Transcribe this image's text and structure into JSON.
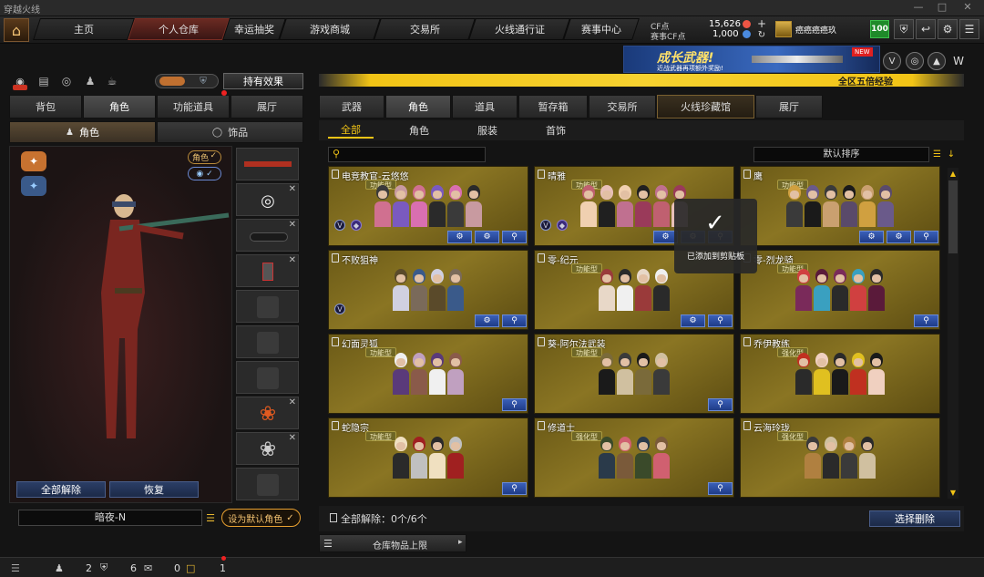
{
  "window": {
    "title": "穿越火线"
  },
  "nav": {
    "tabs": [
      "主页",
      "个人仓库",
      "幸运抽奖",
      "游戏商城",
      "交易所",
      "火线通行证",
      "赛事中心"
    ],
    "active": 1
  },
  "currency": {
    "cf_label": "CF点",
    "cf_value": "15,626",
    "match_label": "赛事CF点",
    "match_value": "1,000"
  },
  "user": {
    "name": "癌癌癌癌玖",
    "level": "100"
  },
  "banner": {
    "title": "成长武器!",
    "subtitle": "近战武器再项额外奖励!",
    "new_badge": "NEW"
  },
  "event_bar": {
    "text": "全区五倍经验"
  },
  "left": {
    "effects_button": "持有效果",
    "tabs": [
      "背包",
      "角色",
      "功能道具",
      "展厅"
    ],
    "active_tab": 1,
    "subtabs": [
      "角色",
      "饰品"
    ],
    "active_subtab": 0,
    "role_badge": "角色",
    "clear_all": "全部解除",
    "restore": "恢复",
    "char_name": "暗夜-N",
    "set_default": "设为默认角色"
  },
  "right": {
    "tabs": [
      "武器",
      "角色",
      "道具",
      "暂存箱",
      "交易所",
      "火线珍藏馆",
      "展厅"
    ],
    "active_tab": 1,
    "filters": [
      "全部",
      "角色",
      "服装",
      "首饰"
    ],
    "active_filter": 0,
    "search_placeholder": "",
    "sort_label": "默认排序",
    "items": [
      {
        "name": "电竞教官-云悠悠",
        "badge": "功能型"
      },
      {
        "name": "晴雅",
        "badge": "功能型"
      },
      {
        "name": "鹰",
        "badge": "功能型"
      },
      {
        "name": "不败狙神",
        "badge": ""
      },
      {
        "name": "零-纪元",
        "badge": "功能型"
      },
      {
        "name": "零-烈龙骑",
        "badge": "功能型"
      },
      {
        "name": "幻面灵狐",
        "badge": "功能型"
      },
      {
        "name": "葵-阿尔法武装",
        "badge": "功能型"
      },
      {
        "name": "乔伊教练",
        "badge": "强化型"
      },
      {
        "name": "蛇隐宗",
        "badge": "功能型"
      },
      {
        "name": "修道士",
        "badge": "强化型"
      },
      {
        "name": "云海玲珑",
        "badge": "强化型"
      }
    ],
    "toast": "已添加到剪贴板",
    "clear_status": "全部解除：0个/6个",
    "select_delete": "选择删除",
    "storage_limit": "仓库物品上限"
  },
  "bottom": {
    "counts": [
      "2",
      "6",
      "0",
      "1"
    ]
  },
  "colors": {
    "accent": "#f2b705",
    "card": "#8a7523",
    "nav_active": "#6a2a22",
    "button": "#2b3e66"
  }
}
